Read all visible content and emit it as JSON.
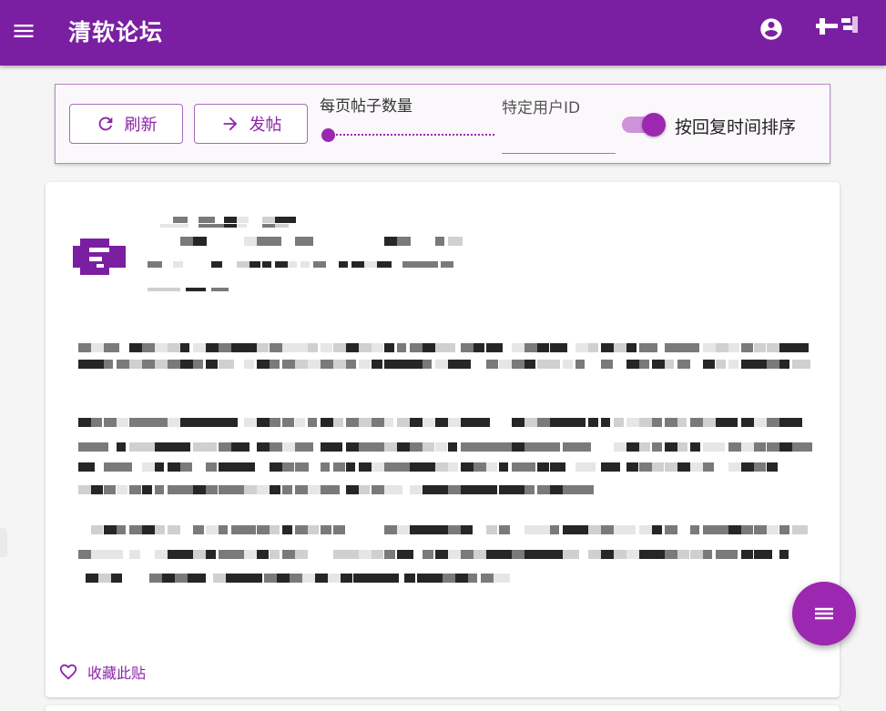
{
  "app": {
    "title": "清软论坛"
  },
  "toolbar": {
    "refresh_label": "刷新",
    "post_label": "发帖",
    "posts_per_page_label": "每页帖子数量",
    "posts_per_page_level": 0,
    "user_id_label": "特定用户ID",
    "user_id_value": "",
    "sort_label": "按回复时间排序",
    "sort_by_reply_time": true
  },
  "post": {
    "favorite_label": "收藏此贴"
  },
  "icons": {
    "menu": "menu-icon",
    "account": "account-circle-icon",
    "refresh": "refresh-icon",
    "post": "arrow-right-icon",
    "favorite": "heart-outline-icon",
    "fab": "menu-icon"
  },
  "colors": {
    "primary": "#7b1fa2",
    "accent": "#9c27b0",
    "accent_light": "#ce93d8"
  }
}
